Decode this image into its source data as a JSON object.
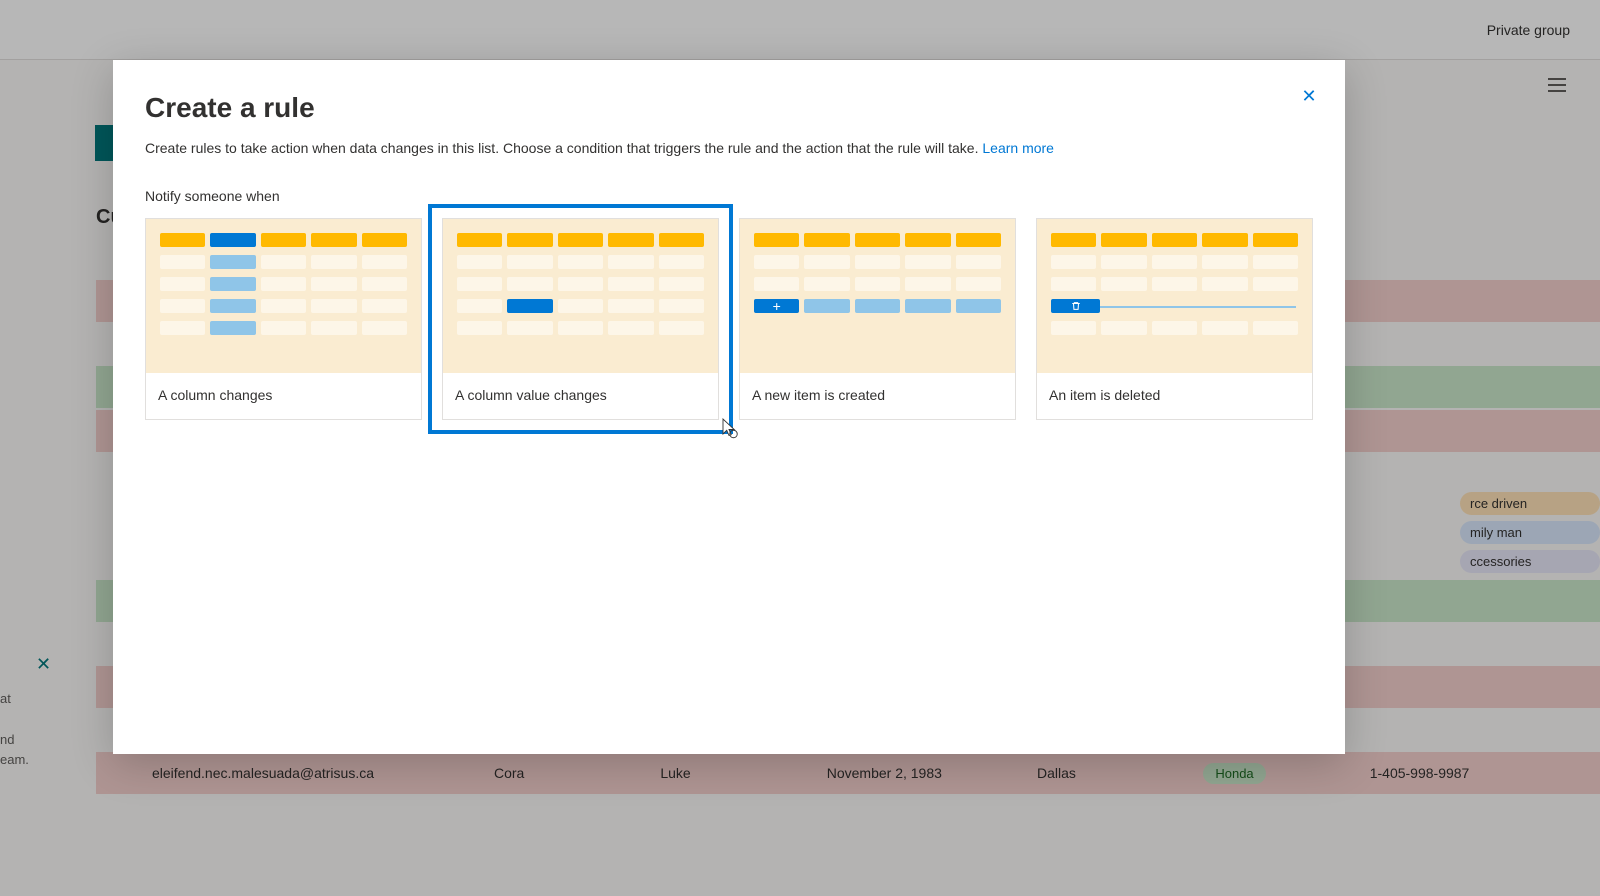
{
  "bg": {
    "header_right": "Private group",
    "title_left": "Cu",
    "row_visible": {
      "email": "eleifend.nec.malesuada@atrisus.ca",
      "first": "Cora",
      "last": "Luke",
      "date": "November 2, 1983",
      "city": "Dallas",
      "badge": "Honda",
      "phone": "1-405-998-9987"
    },
    "tags": [
      "rce driven",
      "mily man",
      "ccessories"
    ],
    "sidepanel": [
      "at",
      "nd",
      "eam."
    ]
  },
  "dialog": {
    "title": "Create a rule",
    "description": "Create rules to take action when data changes in this list. Choose a condition that triggers the rule and the action that the rule will take. ",
    "learn_more": "Learn more",
    "section": "Notify someone when",
    "cards": {
      "column_changes": "A column changes",
      "value_changes": "A column value changes",
      "item_created": "A new item is created",
      "item_deleted": "An item is deleted"
    }
  }
}
